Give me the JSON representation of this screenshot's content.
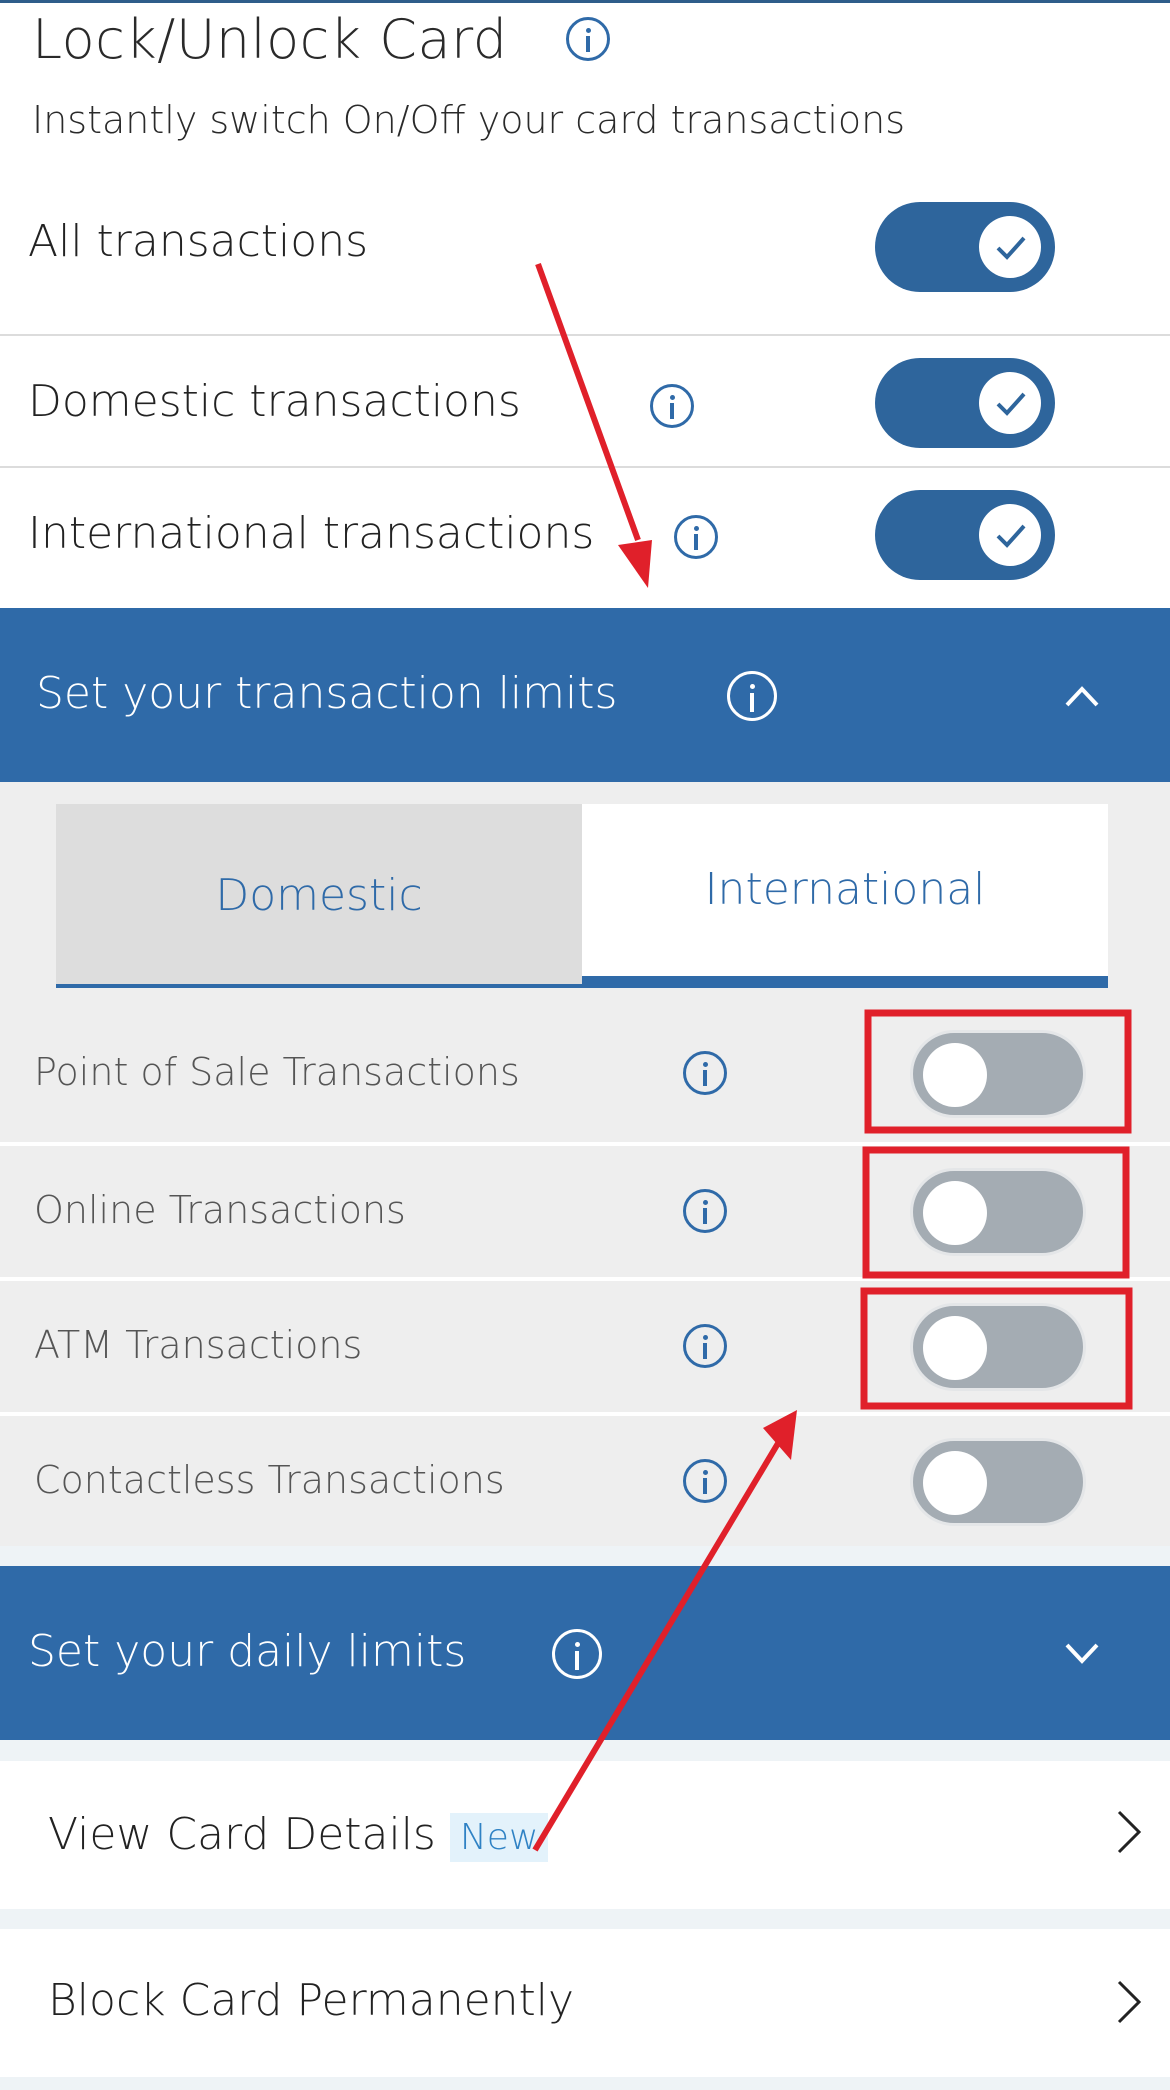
{
  "lock_section": {
    "title": "Lock/Unlock Card",
    "subtitle": "Instantly switch On/Off your card transactions",
    "toggles": [
      {
        "label": "All transactions",
        "state": "on",
        "has_info": false
      },
      {
        "label": "Domestic transactions",
        "state": "on",
        "has_info": true
      },
      {
        "label": "International transactions",
        "state": "on",
        "has_info": true
      }
    ]
  },
  "transaction_limits": {
    "title": "Set your transaction limits",
    "expanded": true,
    "tabs": [
      {
        "label": "Domestic",
        "active": false
      },
      {
        "label": "International",
        "active": true
      }
    ],
    "rows": [
      {
        "label": "Point of Sale Transactions",
        "state": "off",
        "highlighted": true
      },
      {
        "label": "Online Transactions",
        "state": "off",
        "highlighted": true
      },
      {
        "label": "ATM Transactions",
        "state": "off",
        "highlighted": true
      },
      {
        "label": "Contactless Transactions",
        "state": "off",
        "highlighted": false
      }
    ]
  },
  "daily_limits": {
    "title": "Set your daily limits",
    "expanded": false
  },
  "nav": {
    "view_card_details": "View Card Details",
    "new_badge": "New",
    "block_card": "Block Card Permanently"
  },
  "colors": {
    "brand_blue": "#2f6aa8",
    "toggle_on": "#2e659c",
    "toggle_off": "#a4acb3",
    "annotation_red": "#e0202a"
  }
}
